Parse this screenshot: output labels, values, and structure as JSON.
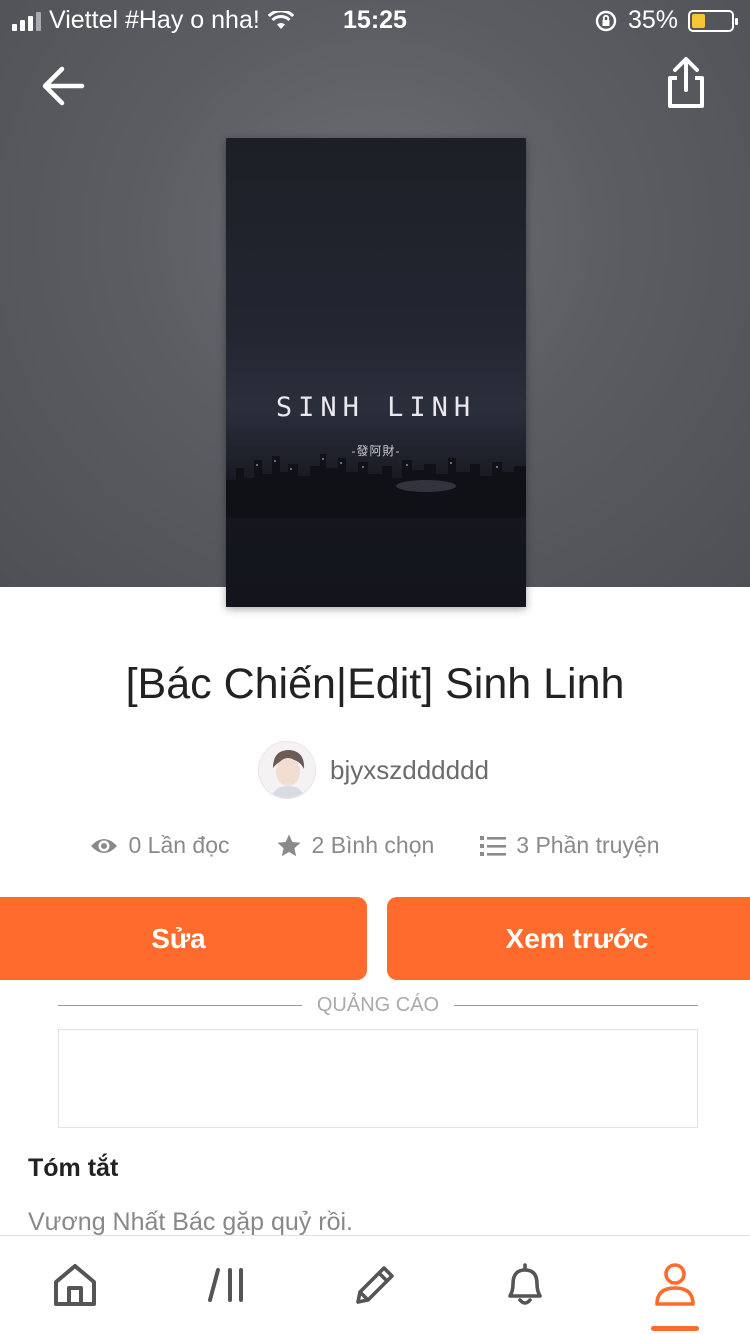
{
  "status_bar": {
    "carrier": "Viettel #Hay o nha!",
    "time": "15:25",
    "battery_percent": "35%",
    "battery_level": 0.35,
    "battery_color": "#f7c531"
  },
  "nav": {
    "back_icon": "arrow-left-icon",
    "share_icon": "share-icon"
  },
  "cover": {
    "title": "SINH LINH",
    "subtitle": "-發阿財-"
  },
  "story": {
    "title": "[Bác Chiến|Edit] Sinh Linh",
    "author": "bjyxszdddddd"
  },
  "stats": {
    "reads": "0 Lần đọc",
    "votes": "2 Bình chọn",
    "parts": "3 Phần truyện"
  },
  "actions": {
    "edit_label": "Sửa",
    "preview_label": "Xem trước",
    "accent_color": "#ff6b2c"
  },
  "ad": {
    "label": "QUẢNG CÁO"
  },
  "summary": {
    "heading": "Tóm tắt",
    "text": "Vương Nhất Bác gặp quỷ rồi."
  },
  "tabbar": {
    "items": [
      {
        "icon": "home-icon"
      },
      {
        "icon": "library-icon"
      },
      {
        "icon": "pencil-icon"
      },
      {
        "icon": "bell-icon"
      },
      {
        "icon": "profile-icon",
        "active": true
      }
    ]
  }
}
